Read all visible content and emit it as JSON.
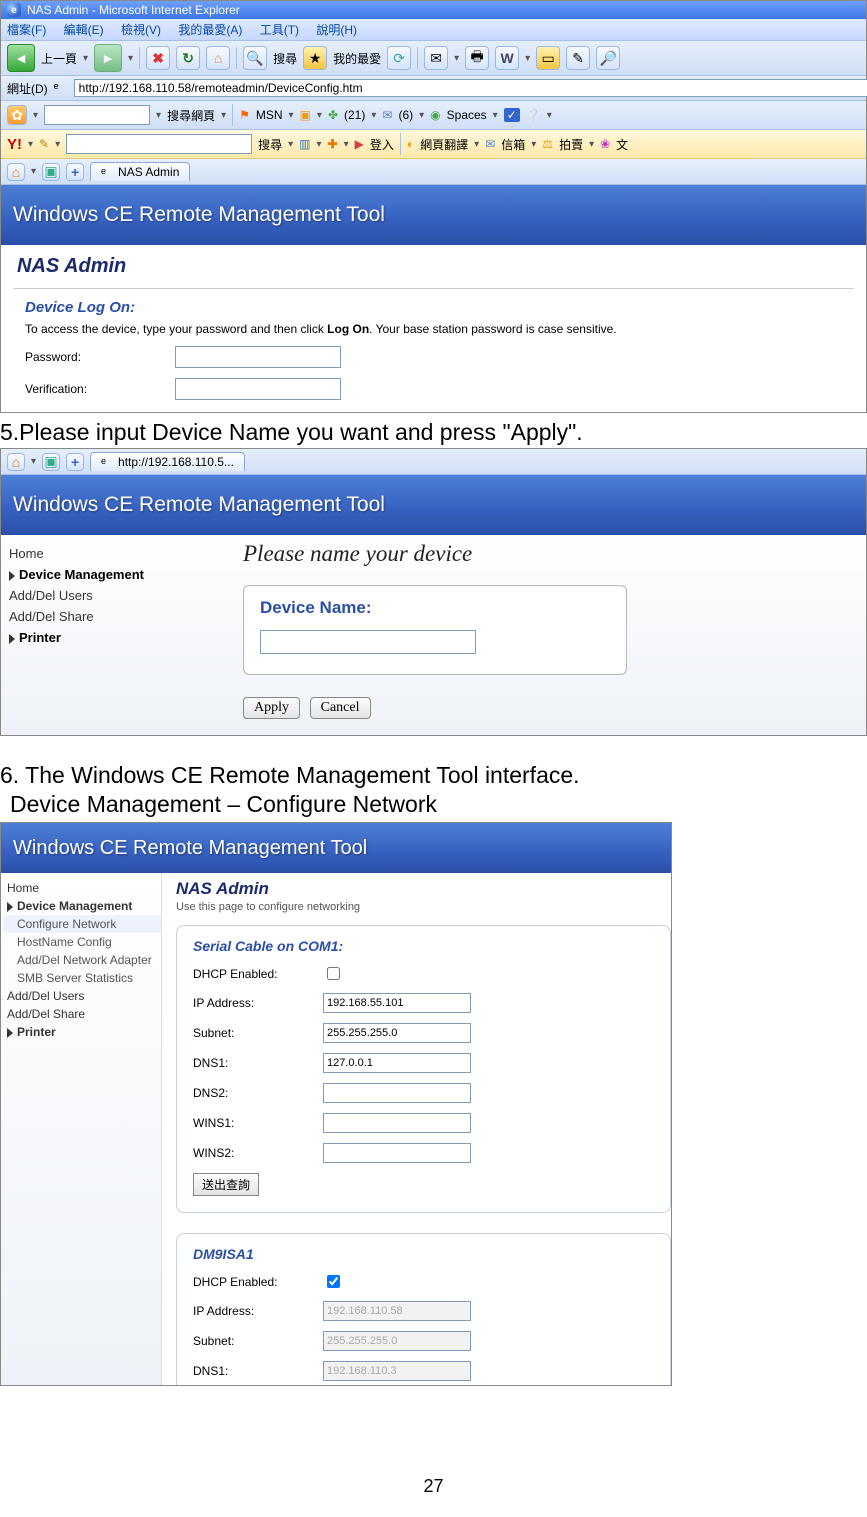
{
  "page_number": "27",
  "shot1": {
    "title": "NAS Admin - Microsoft Internet Explorer",
    "menu": [
      "檔案(F)",
      "編輯(E)",
      "檢視(V)",
      "我的最愛(A)",
      "工具(T)",
      "說明(H)"
    ],
    "back": "上一頁",
    "search": "搜尋",
    "fav": "我的最愛",
    "addr_label": "網址(D)",
    "addr_url": "http://192.168.110.58/remoteadmin/DeviceConfig.htm",
    "tb2_search": "搜尋網頁",
    "tb2_msn": "MSN",
    "tb2_n21": "(21)",
    "tb2_n6": "(6)",
    "tb2_spaces": "Spaces",
    "tb3_y": "Y!",
    "tb3_search": "搜尋",
    "tb3_login": "登入",
    "tb3_trans": "網頁翻譯",
    "tb3_mail": "信箱",
    "tb3_auc": "拍賣",
    "tb3_chi": "文",
    "tab_label": "NAS Admin",
    "banner": "Windows CE Remote Management Tool",
    "nas_title": "NAS Admin",
    "logon_h": "Device Log On:",
    "logon_txt_a": "To access the device, type your password and then click ",
    "logon_txt_b": "Log On",
    "logon_txt_c": ". Your base station password is case sensitive.",
    "pw_label": "Password:",
    "ver_label": "Verification:"
  },
  "step5": "5.Please input Device Name you want and press \"Apply\".",
  "shot2": {
    "url": "http://192.168.110.5...",
    "banner": "Windows CE Remote Management Tool",
    "side": {
      "home": "Home",
      "dm": "Device Management",
      "users": "Add/Del Users",
      "share": "Add/Del Share",
      "printer": "Printer"
    },
    "main_h": "Please name your device",
    "dn_label": "Device Name:",
    "apply": "Apply",
    "cancel": "Cancel"
  },
  "step6a": "6. The Windows CE Remote Management Tool interface.",
  "step6b": "Device Management – Configure Network",
  "shot3": {
    "banner": "Windows CE Remote Management Tool",
    "side": {
      "home": "Home",
      "dm": "Device Management",
      "cn": "Configure Network",
      "hn": "HostName Config",
      "na": "Add/Del Network Adapter",
      "smb": "SMB Server Statistics",
      "users": "Add/Del Users",
      "share": "Add/Del Share",
      "printer": "Printer"
    },
    "nas": "NAS Admin",
    "desc": "Use this page to configure networking",
    "p1": {
      "h": "Serial Cable on COM1:",
      "dhcp": "DHCP Enabled:",
      "ip": "IP Address:",
      "ip_v": "192.168.55.101",
      "sub": "Subnet:",
      "sub_v": "255.255.255.0",
      "d1": "DNS1:",
      "d1_v": "127.0.0.1",
      "d2": "DNS2:",
      "w1": "WINS1:",
      "w2": "WINS2:",
      "btn": "送出查詢"
    },
    "p2": {
      "h": "DM9ISA1",
      "dhcp": "DHCP Enabled:",
      "ip": "IP Address:",
      "ip_v": "192.168.110.58",
      "sub": "Subnet:",
      "sub_v": "255.255.255.0",
      "d1": "DNS1:",
      "d1_v": "192.168.110.3"
    }
  }
}
